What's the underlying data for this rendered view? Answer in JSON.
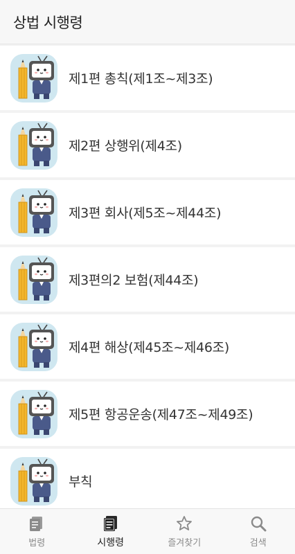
{
  "header": {
    "title": "상법 시행령"
  },
  "rows": [
    {
      "label": "제1편 총칙(제1조~제3조)"
    },
    {
      "label": "제2편 상행위(제4조)"
    },
    {
      "label": "제3편 회사(제5조~제44조)"
    },
    {
      "label": "제3편의2 보험(제44조)"
    },
    {
      "label": "제4편 해상(제45조~제46조)"
    },
    {
      "label": "제5편 항공운송(제47조~제49조)"
    },
    {
      "label": "부칙"
    }
  ],
  "nav": {
    "items": [
      {
        "label": "법령",
        "icon": "law-book-icon",
        "active": false
      },
      {
        "label": "시행령",
        "icon": "decree-book-icon",
        "active": true
      },
      {
        "label": "즐겨찾기",
        "icon": "star-icon",
        "active": false
      },
      {
        "label": "검색",
        "icon": "search-icon",
        "active": false
      }
    ]
  },
  "colors": {
    "avatar_bg": "#cfe7f0",
    "active_nav": "#222222",
    "inactive_nav": "#8a8a8a"
  }
}
